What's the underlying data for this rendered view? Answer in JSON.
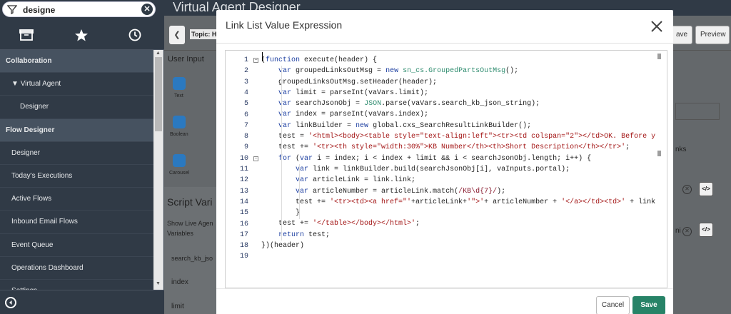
{
  "nav": {
    "filter_value": "designe",
    "items": [
      {
        "label": "Collaboration",
        "kind": "section"
      },
      {
        "label": "Virtual Agent",
        "kind": "mod"
      },
      {
        "label": "Designer",
        "kind": "child"
      },
      {
        "label": "Flow Designer",
        "kind": "section"
      },
      {
        "label": "Designer",
        "kind": "sub"
      },
      {
        "label": "Today's Executions",
        "kind": "sub"
      },
      {
        "label": "Active Flows",
        "kind": "sub"
      },
      {
        "label": "Inbound Email Flows",
        "kind": "sub"
      },
      {
        "label": "Event Queue",
        "kind": "sub"
      },
      {
        "label": "Operations Dashboard",
        "kind": "sub"
      },
      {
        "label": "Settings",
        "kind": "sub"
      }
    ]
  },
  "app": {
    "title": "Virtual Agent Designer",
    "topic_label": "Topic: H",
    "save_btn": "ave",
    "preview_btn": "Preview",
    "user_input_label": "User Input",
    "text_label": "Text",
    "boolean_label": "Boolean",
    "carousel_label": "Carousel",
    "script_variables_label": "Script Vari",
    "show_live_label": "Show Live Agen",
    "variables_label": "Variables",
    "rows": [
      "search_kb_jso",
      "index",
      "limit"
    ],
    "right_text_1": "nks",
    "right_text_2": "ni"
  },
  "modal": {
    "title": "Link List Value Expression",
    "cancel_label": "Cancel",
    "save_label": "Save",
    "code_lines": [
      "(function execute(header) {",
      "    var groupedLinksOutMsg = new sn_cs.GroupedPartsOutMsg();",
      "    groupedLinksOutMsg.setHeader(header);",
      "    var limit = parseInt(vaVars.limit);",
      "    var searchJsonObj = JSON.parse(vaVars.search_kb_json_string);",
      "    var index = parseInt(vaVars.index);",
      "    var linkBuilder = new global.cxs_SearchResultLinkBuilder();",
      "    test = '<html><body><table style=\"text-align:left\"><tr><td colspan=\"2\"></td>OK. Before y",
      "    test += '<tr><th style=\"width:30%\">KB Number</th><th>Short Description</th></tr>';",
      "    for (var i = index; i < index + limit && i < searchJsonObj.length; i++) {",
      "        var link = linkBuilder.build(searchJsonObj[i], vaInputs.portal);",
      "        var articleLink = link.link;",
      "        var articleNumber = articleLink.match(/KB\\d{7}/);",
      "        test += '<tr><td><a href=\"'+articleLink+'\">'+ articleNumber + '</a></td><td>' + link",
      "        }",
      "    test += '</table></body></html>';",
      "    return test;",
      "})(header)",
      ""
    ],
    "line_numbers": [
      "1",
      "2",
      "3",
      "4",
      "5",
      "6",
      "7",
      "8",
      "9",
      "10",
      "11",
      "12",
      "13",
      "14",
      "15",
      "16",
      "17",
      "18",
      "19"
    ]
  }
}
